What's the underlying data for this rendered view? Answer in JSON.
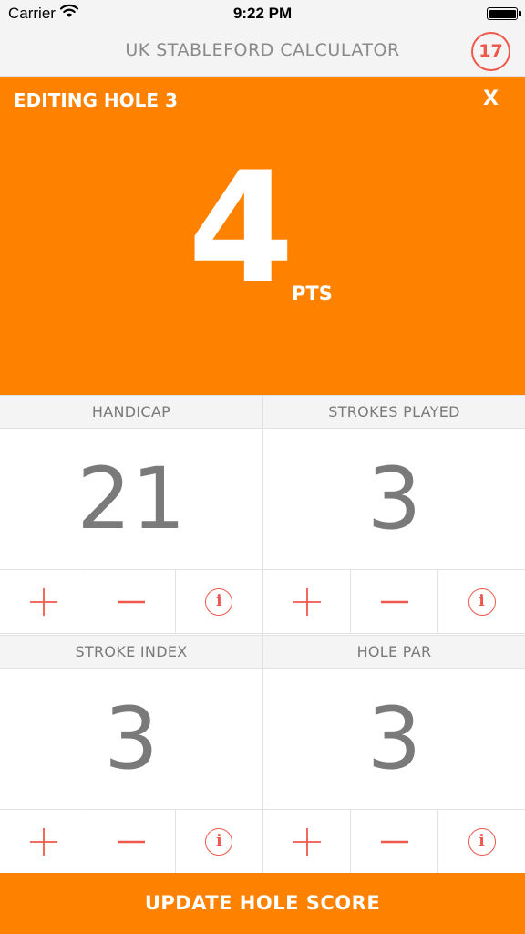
{
  "status_bar": {
    "carrier": "Carrier",
    "time": "9:22 PM"
  },
  "nav": {
    "title": "UK STABLEFORD CALCULATOR",
    "hole_count": "17"
  },
  "panel": {
    "title": "EDITING HOLE 3",
    "close_label": "X",
    "points": "4",
    "points_unit": "PTS"
  },
  "cards": {
    "handicap": {
      "label": "HANDICAP",
      "value": "21"
    },
    "strokes_played": {
      "label": "STROKES PLAYED",
      "value": "3"
    },
    "stroke_index": {
      "label": "STROKE INDEX",
      "value": "3"
    },
    "hole_par": {
      "label": "HOLE PAR",
      "value": "3"
    }
  },
  "controls": {
    "info_glyph": "i"
  },
  "update_button": {
    "label": "UPDATE HOLE SCORE"
  },
  "colors": {
    "accent": "#ff8100",
    "icon": "#f0584c",
    "text_grey": "#7a7a7a",
    "header_bg": "#f4f4f4"
  }
}
